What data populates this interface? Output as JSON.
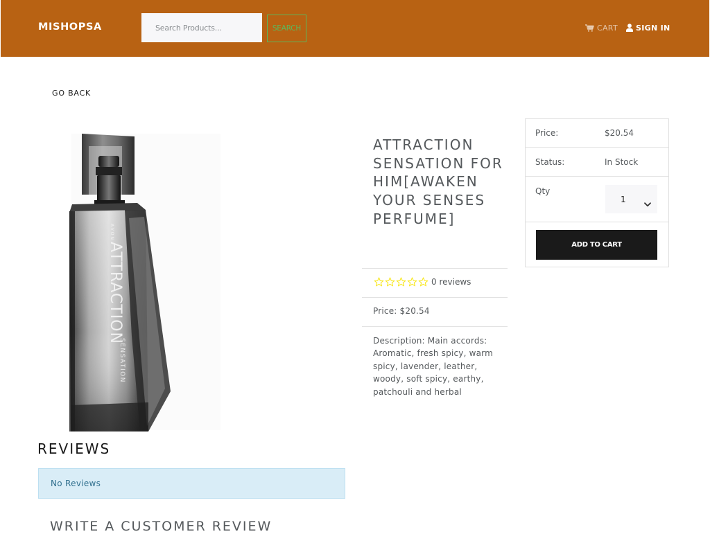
{
  "navbar": {
    "brand": "MISHOPSA",
    "search": {
      "placeholder": "Search Products...",
      "value": ""
    },
    "search_button": "SEARCH",
    "cart_label": "CART",
    "cart_icon": "shopping-cart-icon",
    "signin_label": "SIGN IN",
    "signin_icon": "user-icon",
    "colors": {
      "background": "#b86213",
      "search_button": "#5cb85c"
    }
  },
  "go_back": "GO BACK",
  "product": {
    "title": "ATTRACTION SENSATION FOR HIM[AWAKEN YOUR SENSES PERFUME]",
    "image_alt": "Attraction Sensation perfume bottle",
    "rating": {
      "stars": 0,
      "max": 5,
      "reviews_text": "0 reviews",
      "star_icon": "star-outline-icon",
      "star_color": "#f8e825"
    },
    "price_line": "Price: $20.54",
    "description": "Description: Main accords: Aromatic, fresh spicy, warm spicy, lavender, leather, woody, soft spicy, earthy, patchouli and herbal"
  },
  "buy_card": {
    "price_label": "Price:",
    "price_value": "$20.54",
    "status_label": "Status:",
    "status_value": "In Stock",
    "qty_label": "Qty",
    "qty_value": "1",
    "add_button": "ADD TO CART"
  },
  "reviews": {
    "heading": "REVIEWS",
    "empty_message": "No Reviews",
    "write_heading": "WRITE A CUSTOMER REVIEW"
  }
}
